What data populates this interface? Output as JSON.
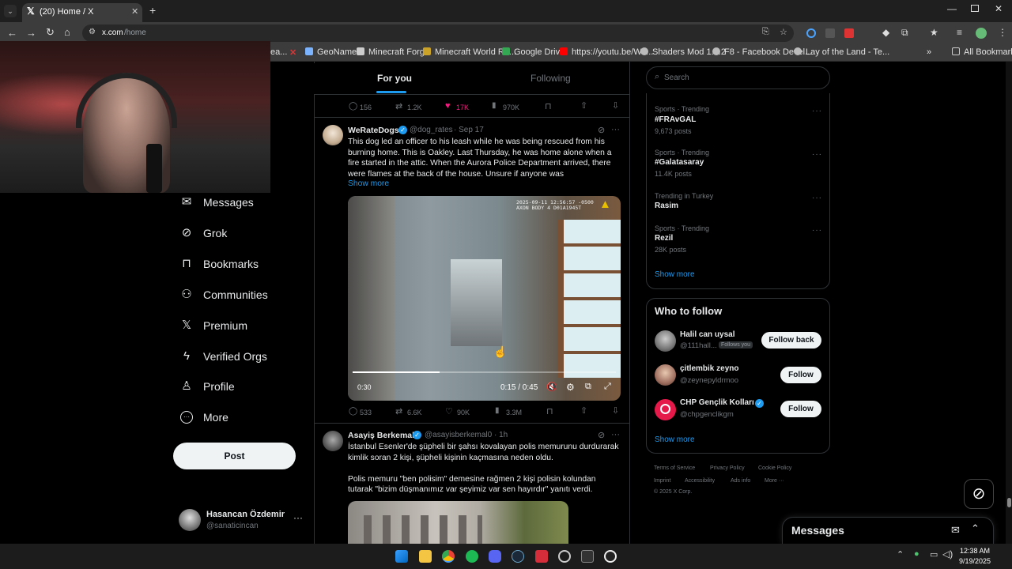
{
  "browser": {
    "tab_title": "(20) Home / X",
    "url_domain": "x.com",
    "url_path": "/home",
    "bookmarks": [
      "ea...",
      "GeoNames",
      "Minecraft Forge",
      "Minecraft World Re...",
      "Google Drive",
      "https://youtu.be/Wx...",
      "Shaders Mod 1.7.2",
      "F8 - Facebook Devel...",
      "Lay of the Land - Te..."
    ],
    "all_bookmarks": "All Bookmarks"
  },
  "nav": {
    "items": [
      {
        "label": "Messages",
        "icon": "mail-icon"
      },
      {
        "label": "Grok",
        "icon": "grok-icon"
      },
      {
        "label": "Bookmarks",
        "icon": "bookmark-icon"
      },
      {
        "label": "Communities",
        "icon": "communities-icon"
      },
      {
        "label": "Premium",
        "icon": "x-logo-icon"
      },
      {
        "label": "Verified Orgs",
        "icon": "lightning-icon"
      },
      {
        "label": "Profile",
        "icon": "person-icon"
      },
      {
        "label": "More",
        "icon": "more-circle-icon"
      }
    ],
    "post_label": "Post",
    "account_name": "Hasancan Özdemir",
    "account_handle": "@sanaticincan"
  },
  "feed": {
    "tab_for_you": "For you",
    "tab_following": "Following",
    "prev_stats": {
      "replies": "156",
      "reposts": "1.2K",
      "likes": "17K",
      "views": "970K"
    },
    "tweet1": {
      "author": "WeRateDogs",
      "handle": "@dog_rates",
      "date": "· Sep 17",
      "text_lines": [
        "This dog led an officer to his leash while he was being rescued from his",
        "burning home. This is Oakley. Last Thursday, he was home alone when a",
        "fire started in the attic. When the Aurora Police Department arrived, there",
        "were flames at the back of the house. Unsure if anyone was"
      ],
      "show_more": "Show more",
      "video_time_current": "0:30",
      "video_progress": "0:15 / 0:45",
      "video_progress_fraction": 0.33,
      "stamp_line1": "2025-09-11 12:56:57 -0500",
      "stamp_line2": "AXON BODY 4 D01A1945T",
      "stats": {
        "replies": "533",
        "reposts": "6.6K",
        "likes": "90K",
        "views": "3.3M"
      }
    },
    "tweet2": {
      "author": "Asayiş Berkemal",
      "handle": "@asayisberkemal0",
      "date": "· 1h",
      "text_lines": [
        "İstanbul Esenler'de şüpheli bir şahsı kovalayan polis memurunu durdurarak",
        "kimlik soran 2 kişi, şüpheli kişinin kaçmasına neden oldu.",
        "",
        "Polis memuru \"ben polisim\" demesine rağmen 2 kişi polisin kolundan",
        "tutarak \"bizim düşmanımız var şeyimiz var sen hayırdır\" yanıtı verdi."
      ]
    }
  },
  "sidebar": {
    "search_placeholder": "Search",
    "trends": [
      {
        "category": "Sports · Trending",
        "name": "#FRAvGAL",
        "count": "9,673 posts"
      },
      {
        "category": "Sports · Trending",
        "name": "#Galatasaray",
        "count": "11.4K posts"
      },
      {
        "category": "Trending in Turkey",
        "name": "Rasim",
        "count": ""
      },
      {
        "category": "Sports · Trending",
        "name": "Rezil",
        "count": "28K posts"
      }
    ],
    "show_more": "Show more",
    "who_to_follow_title": "Who to follow",
    "follow": [
      {
        "name": "Halil can uysal",
        "handle": "@111hall...",
        "badge": "Follows you",
        "button": "Follow back"
      },
      {
        "name": "çitlembik zeyno",
        "handle": "@zeynepyldrmoo",
        "badge": "",
        "button": "Follow"
      },
      {
        "name": "CHP Gençlik Kolları",
        "handle": "@chpgenclikgm",
        "badge": "",
        "button": "Follow"
      }
    ],
    "show_more_follow": "Show more",
    "footer": [
      "Terms of Service",
      "Privacy Policy",
      "Cookie Policy",
      "Imprint",
      "Accessibility",
      "Ads info",
      "More ···",
      "© 2025 X Corp."
    ]
  },
  "messages_drawer": {
    "title": "Messages"
  },
  "taskbar": {
    "time": "12:38 AM",
    "date": "9/19/2025"
  },
  "colors": {
    "accent": "#1d9bf0",
    "like": "#f91880",
    "bg": "#000000",
    "border": "#2f3336"
  }
}
